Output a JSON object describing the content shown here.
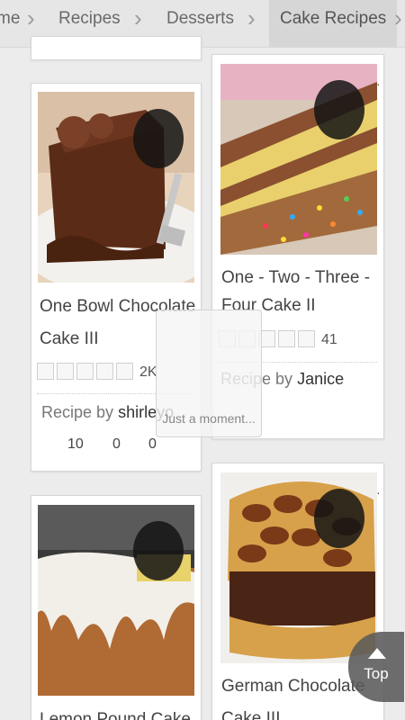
{
  "breadcrumb": {
    "items": [
      "me",
      "Recipes",
      "Desserts",
      "Cake Recipes"
    ]
  },
  "recipes": [
    {
      "title_line1": "One Bowl Chocolate",
      "title_line2": "Cake III",
      "rating_count": "2K",
      "byline_prefix": "Recipe by",
      "author": "shirleyo",
      "stats": [
        "10",
        "0",
        "0"
      ]
    },
    {
      "title_line1": "One - Two - Three -",
      "title_line2": "Four Cake II",
      "rating_count": "41",
      "byline_prefix": "Recipe by",
      "author": "Janice"
    },
    {
      "title_line1": "Lemon Pound Cake"
    },
    {
      "title_line1": "German Chocolate",
      "title_line2": "Cake III"
    }
  ],
  "loading": {
    "text": "Just a moment..."
  },
  "top_button": {
    "label": "Top"
  }
}
